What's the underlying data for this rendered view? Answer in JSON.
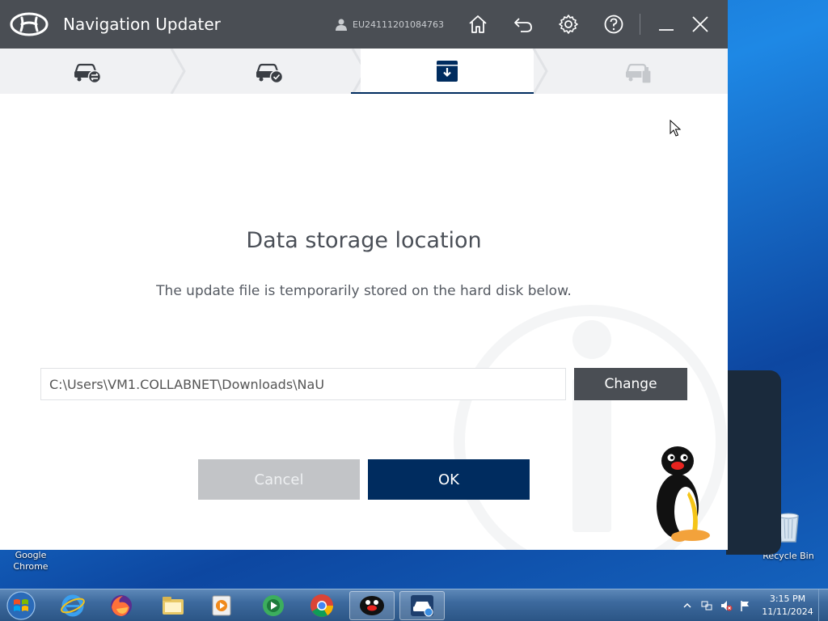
{
  "window": {
    "title": "Navigation Updater",
    "user_id": "EU24111201084763"
  },
  "steps": [
    {
      "name": "car-swap",
      "state": "done"
    },
    {
      "name": "car-check",
      "state": "done"
    },
    {
      "name": "download",
      "state": "active"
    },
    {
      "name": "car-usb",
      "state": "disabled"
    }
  ],
  "dialog": {
    "heading": "Data storage location",
    "description": "The update file is temporarily stored on the hard disk below.",
    "path_value": "C:\\Users\\VM1.COLLABNET\\Downloads\\NaU",
    "change_label": "Change",
    "cancel_label": "Cancel",
    "ok_label": "OK"
  },
  "desktop": {
    "chrome_label_1": "Google",
    "chrome_label_2": "Chrome",
    "recycle_label": "Recycle Bin"
  },
  "taskbar": {
    "items": [
      "start-orb",
      "internet-explorer",
      "firefox",
      "file-explorer",
      "media-player",
      "synergy",
      "chrome",
      "pingu",
      "navigation-updater"
    ],
    "time": "3:15 PM",
    "date": "11/11/2024"
  },
  "colors": {
    "titlebar": "#4a4e54",
    "primary": "#002c5f",
    "disabled_button": "#c2c4c7"
  }
}
